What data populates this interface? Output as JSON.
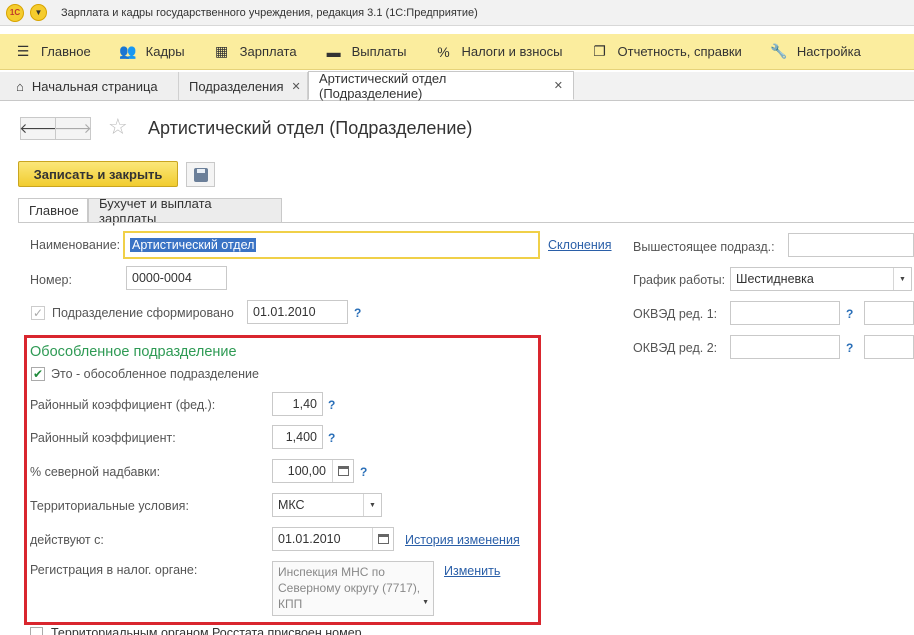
{
  "window": {
    "title": "Зарплата и кадры государственного учреждения, редакция 3.1  (1С:Предприятие)",
    "logo": "1С"
  },
  "main_menu": [
    {
      "label": "Главное",
      "icon": "hamburger-icon"
    },
    {
      "label": "Кадры",
      "icon": "people-icon"
    },
    {
      "label": "Зарплата",
      "icon": "calculator-icon"
    },
    {
      "label": "Выплаты",
      "icon": "wallet-icon"
    },
    {
      "label": "Налоги и взносы",
      "icon": "percent-icon"
    },
    {
      "label": "Отчетность, справки",
      "icon": "reports-icon"
    },
    {
      "label": "Настройка",
      "icon": "wrench-icon"
    }
  ],
  "tabs": [
    {
      "label": "Начальная страница",
      "closable": false
    },
    {
      "label": "Подразделения",
      "closable": true
    },
    {
      "label": "Артистический отдел (Подразделение)",
      "closable": true,
      "active": true
    }
  ],
  "form": {
    "title": "Артистический отдел (Подразделение)",
    "save_close_label": "Записать и закрыть",
    "tabs": [
      {
        "label": "Главное",
        "active": true
      },
      {
        "label": "Бухучет и выплата зарплаты",
        "active": false
      }
    ],
    "name_label": "Наименование:",
    "name_value": "Артистический отдел",
    "declensions_link": "Склонения",
    "number_label": "Номер:",
    "number_value": "0000-0004",
    "formed_label": "Подразделение сформировано",
    "formed_checked": true,
    "formed_date": "01.01.2010",
    "help": "?",
    "parent_label": "Вышестоящее подразд.:",
    "parent_value": "",
    "schedule_label": "График работы:",
    "schedule_value": "Шестидневка",
    "okved1_label": "ОКВЭД ред. 1:",
    "okved2_label": "ОКВЭД ред. 2:"
  },
  "separate_unit": {
    "title": "Обособленное подразделение",
    "is_separate_label": "Это - обособленное подразделение",
    "is_separate_checked": true,
    "fed_coef_label": "Районный коэффициент (фед.):",
    "fed_coef_value": "1,40",
    "coef_label": "Районный коэффициент:",
    "coef_value": "1,400",
    "north_label": "% северной надбавки:",
    "north_value": "100,00",
    "territory_label": "Территориальные условия:",
    "territory_value": "МКС",
    "valid_from_label": "действуют с:",
    "valid_from_value": "01.01.2010",
    "history_link": "История изменения",
    "tax_reg_label": "Регистрация в налог. органе:",
    "tax_reg_value": "Инспекция МНС по Северному округу (7717), КПП",
    "change_link": "Изменить"
  },
  "footer": {
    "rosstat_label": "Территориальным органом Росстата присвоен номер"
  },
  "colors": {
    "menu_bg": "#fbed9e",
    "primary_button": "#f1cc2f",
    "section_title": "#2e9a54",
    "highlight_frame": "#d9262e",
    "link": "#2a5fa8"
  }
}
